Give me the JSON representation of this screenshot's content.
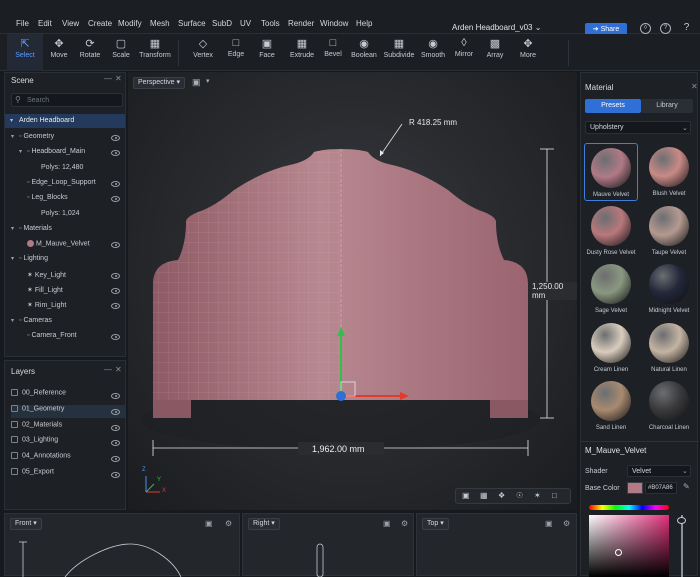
{
  "menu": [
    "File",
    "Edit",
    "View",
    "Create",
    "Modify",
    "Mesh",
    "Surface",
    "SubD",
    "UV",
    "Tools",
    "Render",
    "Window",
    "Help"
  ],
  "doc_title": "Arden Headboard_v03",
  "share_label": "Share",
  "tools": [
    {
      "label": "Select",
      "icon": "cursor-icon"
    },
    {
      "label": "Move",
      "icon": "move-icon"
    },
    {
      "label": "Rotate",
      "icon": "rotate-icon"
    },
    {
      "label": "Scale",
      "icon": "scale-icon"
    },
    {
      "label": "Transform",
      "icon": "transform-icon"
    },
    {
      "label": "Vertex",
      "icon": "vertex-icon"
    },
    {
      "label": "Edge",
      "icon": "edge-icon"
    },
    {
      "label": "Face",
      "icon": "face-icon"
    },
    {
      "label": "Extrude",
      "icon": "extrude-icon"
    },
    {
      "label": "Bevel",
      "icon": "bevel-icon"
    },
    {
      "label": "Boolean",
      "icon": "boolean-icon"
    },
    {
      "label": "Subdivide",
      "icon": "subdivide-icon"
    },
    {
      "label": "Smooth",
      "icon": "smooth-icon"
    },
    {
      "label": "Mirror",
      "icon": "mirror-icon"
    },
    {
      "label": "Array",
      "icon": "array-icon"
    },
    {
      "label": "More",
      "icon": "more-icon"
    }
  ],
  "scene": {
    "title": "Scene",
    "search_placeholder": "Search",
    "root": "Arden Headboard",
    "items": [
      {
        "label": "Geometry",
        "indent": 0,
        "eye": true
      },
      {
        "label": "Headboard_Main",
        "indent": 1,
        "eye": true
      },
      {
        "label": "Polys: 12,480",
        "indent": 2,
        "eye": false
      },
      {
        "label": "Edge_Loop_Support",
        "indent": 1,
        "eye": true
      },
      {
        "label": "Leg_Blocks",
        "indent": 1,
        "eye": true
      },
      {
        "label": "Polys: 1,024",
        "indent": 2,
        "eye": false
      },
      {
        "label": "Materials",
        "indent": 0,
        "eye": false
      },
      {
        "label": "M_Mauve_Velvet",
        "indent": 1,
        "eye": true
      },
      {
        "label": "Lighting",
        "indent": 0,
        "eye": false
      },
      {
        "label": "Key_Light",
        "indent": 1,
        "eye": true
      },
      {
        "label": "Fill_Light",
        "indent": 1,
        "eye": true
      },
      {
        "label": "Rim_Light",
        "indent": 1,
        "eye": true
      },
      {
        "label": "Cameras",
        "indent": 0,
        "eye": false
      },
      {
        "label": "Camera_Front",
        "indent": 1,
        "eye": true
      }
    ]
  },
  "layers": {
    "title": "Layers",
    "items": [
      "00_Reference",
      "01_Geometry",
      "02_Materials",
      "03_Lighting",
      "04_Annotations",
      "05_Export"
    ]
  },
  "viewport": {
    "camera": "Perspective",
    "radius_label": "R 418.25 mm",
    "height_label": "1,250.00 mm",
    "width_label": "1,962.00 mm",
    "axis_z": "Z",
    "axis_y": "Y",
    "axis_x": "X"
  },
  "material": {
    "title": "Material",
    "tab_presets": "Presets",
    "tab_library": "Library",
    "category": "Upholstery",
    "swatches": [
      {
        "name": "Mauve Velvet",
        "color": "#b07a86"
      },
      {
        "name": "Blush Velvet",
        "color": "#c98a86"
      },
      {
        "name": "Dusty Rose Velvet",
        "color": "#b8787c"
      },
      {
        "name": "Taupe Velvet",
        "color": "#b49a90"
      },
      {
        "name": "Sage Velvet",
        "color": "#8a9880"
      },
      {
        "name": "Midnight Velvet",
        "color": "#23283a"
      },
      {
        "name": "Cream Linen",
        "color": "#d9ccbc"
      },
      {
        "name": "Natural Linen",
        "color": "#c4b4a2"
      },
      {
        "name": "Sand Linen",
        "color": "#a88a70"
      },
      {
        "name": "Charcoal Linen",
        "color": "#3a3a3c"
      }
    ],
    "selected_name": "M_Mauve_Velvet",
    "shader_label": "Shader",
    "shader_value": "Velvet",
    "base_color_label": "Base Color",
    "base_color_hex": "#B07A86"
  },
  "bottom_views": [
    "Front",
    "Right",
    "Top"
  ]
}
